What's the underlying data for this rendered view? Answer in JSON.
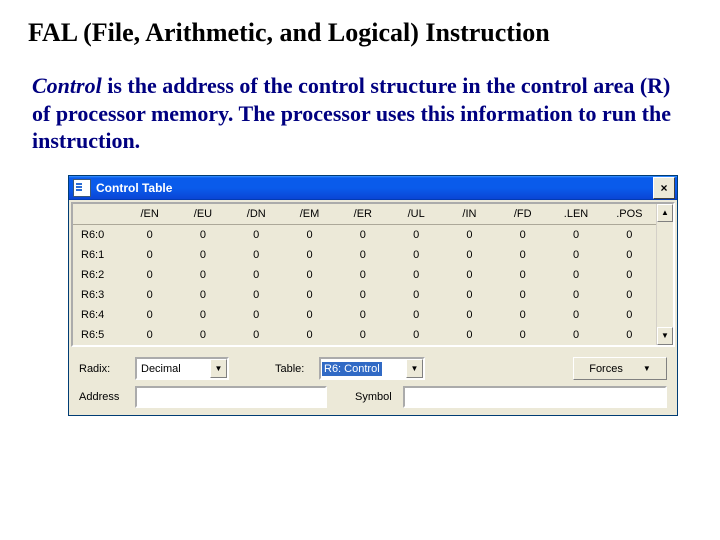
{
  "slide": {
    "title": "FAL (File, Arithmetic, and Logical) Instruction",
    "lead_word": "Control",
    "body_rest": " is the address of the control structure in the control area (R) of processor memory. The processor uses this information to run the instruction."
  },
  "window": {
    "title": "Control Table",
    "close_label": "×",
    "columns": [
      "",
      "/EN",
      "/EU",
      "/DN",
      "/EM",
      "/ER",
      "/UL",
      "/IN",
      "/FD",
      ".LEN",
      ".POS"
    ],
    "rows": [
      {
        "hdr": "R6:0",
        "cells": [
          "0",
          "0",
          "0",
          "0",
          "0",
          "0",
          "0",
          "0",
          "0",
          "0"
        ]
      },
      {
        "hdr": "R6:1",
        "cells": [
          "0",
          "0",
          "0",
          "0",
          "0",
          "0",
          "0",
          "0",
          "0",
          "0"
        ]
      },
      {
        "hdr": "R6:2",
        "cells": [
          "0",
          "0",
          "0",
          "0",
          "0",
          "0",
          "0",
          "0",
          "0",
          "0"
        ]
      },
      {
        "hdr": "R6:3",
        "cells": [
          "0",
          "0",
          "0",
          "0",
          "0",
          "0",
          "0",
          "0",
          "0",
          "0"
        ]
      },
      {
        "hdr": "R6:4",
        "cells": [
          "0",
          "0",
          "0",
          "0",
          "0",
          "0",
          "0",
          "0",
          "0",
          "0"
        ]
      },
      {
        "hdr": "R6:5",
        "cells": [
          "0",
          "0",
          "0",
          "0",
          "0",
          "0",
          "0",
          "0",
          "0",
          "0"
        ]
      }
    ],
    "scroll_up": "▲",
    "scroll_down": "▼",
    "radix_label": "Radix:",
    "radix_value": "Decimal",
    "table_label": "Table:",
    "table_value": "R6: Control",
    "forces_label": "Forces",
    "address_label": "Address",
    "symbol_label": "Symbol",
    "combo_arrow": "▼"
  }
}
